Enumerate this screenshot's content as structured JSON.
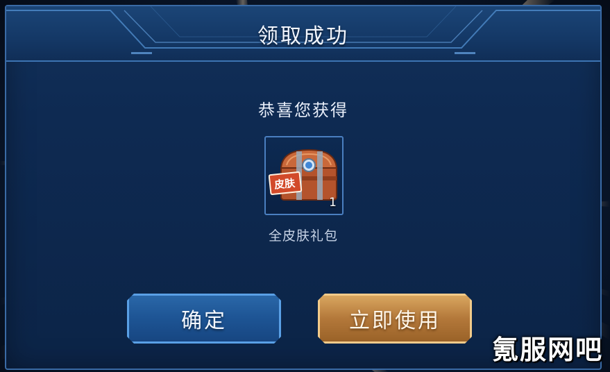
{
  "dialog": {
    "title": "领取成功",
    "subtitle": "恭喜您获得"
  },
  "reward": {
    "icon": "skin-chest-icon",
    "icon_label": "皮肤",
    "count": "1",
    "name": "全皮肤礼包"
  },
  "buttons": {
    "confirm_label": "确定",
    "use_label": "立即使用"
  },
  "watermark": "氪服网吧",
  "colors": {
    "dialog_bg": "#0e2a52",
    "frame": "#3a6ba6",
    "confirm_button": "#1d5494",
    "use_button": "#b3783a"
  }
}
